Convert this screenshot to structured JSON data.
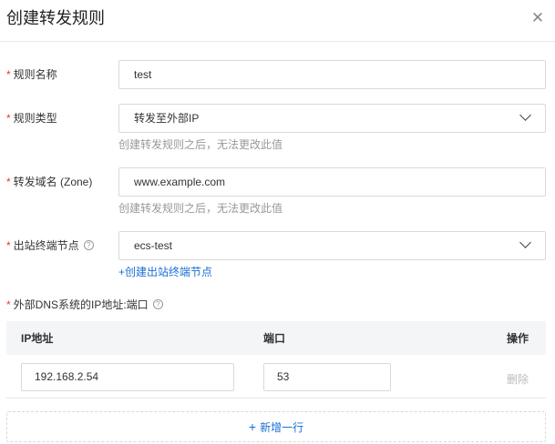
{
  "dialog": {
    "title": "创建转发规则",
    "close_icon": "✕"
  },
  "form": {
    "required_mark": "*",
    "rule_name": {
      "label": "规则名称",
      "value": "test"
    },
    "rule_type": {
      "label": "规则类型",
      "value": "转发至外部IP",
      "hint": "创建转发规则之后，无法更改此值"
    },
    "zone": {
      "label": "转发域名 (Zone)",
      "value": "www.example.com",
      "hint": "创建转发规则之后，无法更改此值"
    },
    "outbound_node": {
      "label": "出站终端节点",
      "value": "ecs-test",
      "help_icon": "?",
      "create_link": "+创建出站终端节点"
    },
    "external_dns": {
      "label": "外部DNS系统的IP地址:端口",
      "help_icon": "?"
    }
  },
  "table": {
    "headers": {
      "ip": "IP地址",
      "port": "端口",
      "actions": "操作"
    },
    "rows": [
      {
        "ip": "192.168.2.54",
        "port": "53",
        "delete": "删除"
      }
    ],
    "add_row": {
      "plus": "+",
      "label": "新增一行"
    }
  }
}
